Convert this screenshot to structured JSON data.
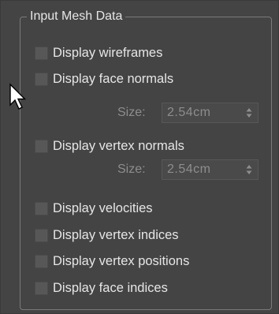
{
  "panel": {
    "title": "Input Mesh Data",
    "checkboxes": [
      {
        "label": "Display wireframes",
        "checked": false
      },
      {
        "label": "Display face normals",
        "checked": false
      },
      {
        "label": "Display vertex normals",
        "checked": false
      },
      {
        "label": "Display velocities",
        "checked": false
      },
      {
        "label": "Display vertex indices",
        "checked": false
      },
      {
        "label": "Display vertex positions",
        "checked": false
      },
      {
        "label": "Display face indices",
        "checked": false
      }
    ],
    "face_normals_size": {
      "label": "Size:",
      "value": "2.54cm",
      "enabled": false
    },
    "vertex_normals_size": {
      "label": "Size:",
      "value": "2.54cm",
      "enabled": false
    }
  },
  "colors": {
    "background": "#444444",
    "text": "#e6e6e6",
    "disabled_text": "#8d8d8d",
    "checkbox_fill": "#575757",
    "group_border": "#7a7a7a"
  },
  "icons": {
    "spinner": "up-down-arrows-icon",
    "cursor": "mouse-pointer-icon"
  }
}
